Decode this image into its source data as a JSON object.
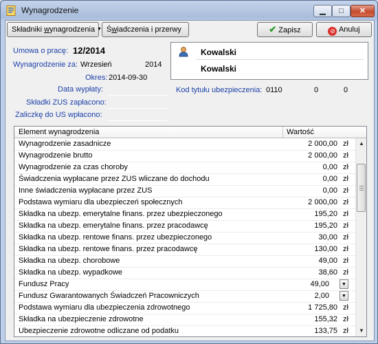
{
  "window": {
    "title": "Wynagrodzenie"
  },
  "toolbar": {
    "components_pre": "Składniki ",
    "components_u": "w",
    "components_post": "ynagrodzenia",
    "benefits_pre": "Ś",
    "benefits_u": "w",
    "benefits_post": "iadczenia i przerwy",
    "save_label": "Zapisz",
    "cancel_label": "Anuluj"
  },
  "header": {
    "contract_label": "Umowa o pracę:",
    "contract_value": "12/2014",
    "salary_for_label": "Wynagrodzenie za:",
    "salary_month": "Wrzesień",
    "salary_year": "2014",
    "period_label": "Okres:",
    "period_value": "2014-09-30",
    "payout_label": "Data wypłaty:",
    "zus_label": "Składki ZUS zapłacono:",
    "us_label": "Zaliczkę do US wpłacono:",
    "insurance_label": "Kod tytułu ubezpieczenia:",
    "insurance_code": "0110",
    "insurance_c2": "0",
    "insurance_c3": "0"
  },
  "person": {
    "line1": "Kowalski",
    "line2": "Kowalski"
  },
  "grid": {
    "col_name": "Element wynagrodzenia",
    "col_value": "Wartość",
    "currency": "zł",
    "rows": [
      {
        "name": "Wynagrodzenie zasadnicze",
        "value": "2 000,00"
      },
      {
        "name": "Wynagrodzenie brutto",
        "value": "2 000,00"
      },
      {
        "name": "Wynagrodzenie za czas choroby",
        "value": "0,00"
      },
      {
        "name": "Świadczenia wypłacane przez ZUS wliczane do dochodu",
        "value": "0,00"
      },
      {
        "name": "Inne świadczenia wypłacane przez ZUS",
        "value": "0,00"
      },
      {
        "name": "Podstawa wymiaru dla ubezpieczeń społecznych",
        "value": "2 000,00"
      },
      {
        "name": "Składka na ubezp. emerytalne finans. przez ubezpieczonego",
        "value": "195,20"
      },
      {
        "name": "Składka na ubezp. emerytalne finans. przez pracodawcę",
        "value": "195,20"
      },
      {
        "name": "Składka na ubezp. rentowe finans. przez ubezpieczonego",
        "value": "30,00"
      },
      {
        "name": "Składka na ubezp. rentowe finans. przez pracodawcę",
        "value": "130,00"
      },
      {
        "name": "Składka na ubezp. chorobowe",
        "value": "49,00"
      },
      {
        "name": "Składka na ubezp. wypadkowe",
        "value": "38,60"
      },
      {
        "name": "Fundusz Pracy",
        "value": "49,00"
      },
      {
        "name": "Fundusz Gwarantowanych Świadczeń Pracowniczych",
        "value": "2,00"
      },
      {
        "name": "Podstawa wymiaru dla ubezpieczenia zdrowotnego",
        "value": "1 725,80"
      },
      {
        "name": "Składka na ubezpieczenie zdrowotne",
        "value": "155,32"
      },
      {
        "name": "Ubezpieczenie zdrowotne odliczane od podatku",
        "value": "133,75"
      }
    ]
  }
}
